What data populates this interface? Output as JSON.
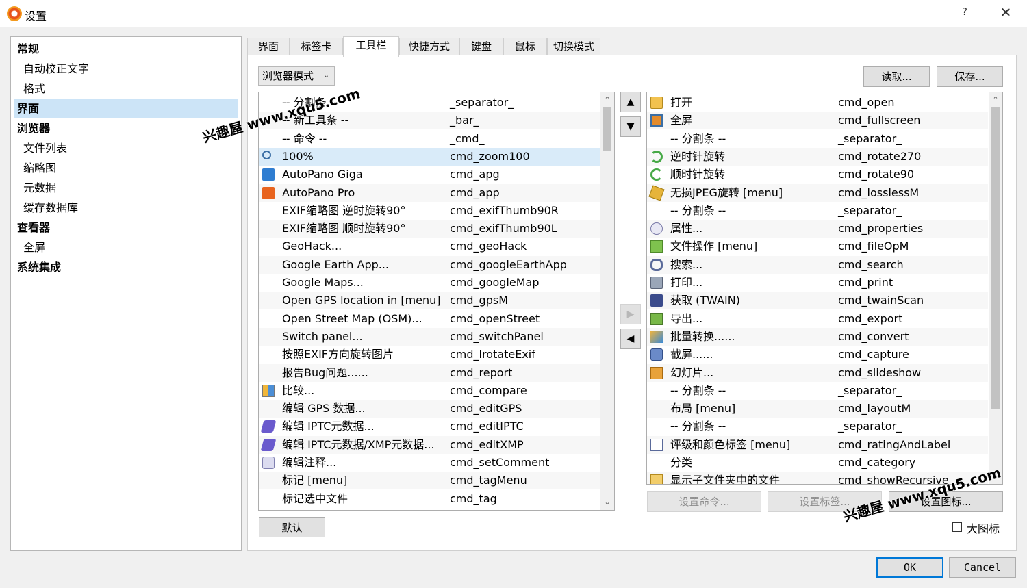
{
  "window": {
    "title": "设置",
    "help": "?",
    "close": "✕"
  },
  "nav": {
    "items": [
      {
        "label": "常规",
        "level": 0
      },
      {
        "label": "自动校正文字",
        "level": 1
      },
      {
        "label": "格式",
        "level": 1
      },
      {
        "label": "界面",
        "level": 0,
        "selected": true
      },
      {
        "label": "浏览器",
        "level": 0
      },
      {
        "label": "文件列表",
        "level": 1
      },
      {
        "label": "缩略图",
        "level": 1
      },
      {
        "label": "元数据",
        "level": 1
      },
      {
        "label": "缓存数据库",
        "level": 1
      },
      {
        "label": "查看器",
        "level": 0
      },
      {
        "label": "全屏",
        "level": 1
      },
      {
        "label": "系统集成",
        "level": 0
      }
    ]
  },
  "tabs": [
    {
      "label": "界面"
    },
    {
      "label": "标签卡"
    },
    {
      "label": "工具栏",
      "active": true
    },
    {
      "label": "快捷方式"
    },
    {
      "label": "键盘"
    },
    {
      "label": "鼠标"
    },
    {
      "label": "切换模式"
    }
  ],
  "toolbar": {
    "mode_value": "浏览器模式",
    "load_label": "读取...",
    "save_label": "保存..."
  },
  "available": [
    {
      "name": "-- 分割条 --",
      "cmd": "_separator_",
      "icon": ""
    },
    {
      "name": "-- 新工具条 --",
      "cmd": "_bar_",
      "icon": ""
    },
    {
      "name": "-- 命令 --",
      "cmd": "_cmd_",
      "icon": ""
    },
    {
      "name": "100%",
      "cmd": "cmd_zoom100",
      "icon": "zoom-icon",
      "selected": true
    },
    {
      "name": "AutoPano Giga",
      "cmd": "cmd_apg",
      "icon": "apg-icon"
    },
    {
      "name": "AutoPano Pro",
      "cmd": "cmd_app",
      "icon": "app-icon"
    },
    {
      "name": "EXIF缩略图 逆时旋转90°",
      "cmd": "cmd_exifThumb90R",
      "icon": ""
    },
    {
      "name": "EXIF缩略图 顺时旋转90°",
      "cmd": "cmd_exifThumb90L",
      "icon": ""
    },
    {
      "name": "GeoHack...",
      "cmd": "cmd_geoHack",
      "icon": ""
    },
    {
      "name": "Google Earth App...",
      "cmd": "cmd_googleEarthApp",
      "icon": ""
    },
    {
      "name": "Google Maps...",
      "cmd": "cmd_googleMap",
      "icon": ""
    },
    {
      "name": "Open GPS location in [menu]",
      "cmd": "cmd_gpsM",
      "icon": ""
    },
    {
      "name": "Open Street Map (OSM)...",
      "cmd": "cmd_openStreet",
      "icon": ""
    },
    {
      "name": "Switch panel...",
      "cmd": "cmd_switchPanel",
      "icon": ""
    },
    {
      "name": "按照EXIF方向旋转图片",
      "cmd": "cmd_lrotateExif",
      "icon": ""
    },
    {
      "name": "报告Bug问题......",
      "cmd": "cmd_report",
      "icon": ""
    },
    {
      "name": "比较...",
      "cmd": "cmd_compare",
      "icon": "compare-icon"
    },
    {
      "name": "编辑 GPS 数据...",
      "cmd": "cmd_editGPS",
      "icon": ""
    },
    {
      "name": "编辑 IPTC元数据...",
      "cmd": "cmd_editIPTC",
      "icon": "edit-meta-icon"
    },
    {
      "name": "编辑 IPTC元数据/XMP元数据...",
      "cmd": "cmd_editXMP",
      "icon": "edit-meta-icon"
    },
    {
      "name": "编辑注释...",
      "cmd": "cmd_setComment",
      "icon": "comment-icon"
    },
    {
      "name": "标记 [menu]",
      "cmd": "cmd_tagMenu",
      "icon": ""
    },
    {
      "name": "标记选中文件",
      "cmd": "cmd_tag",
      "icon": ""
    }
  ],
  "current": [
    {
      "name": "打开",
      "cmd": "cmd_open",
      "icon": "open-icon"
    },
    {
      "name": "全屏",
      "cmd": "cmd_fullscreen",
      "icon": "fullscreen-icon"
    },
    {
      "name": "-- 分割条 --",
      "cmd": "_separator_",
      "icon": ""
    },
    {
      "name": "逆时针旋转",
      "cmd": "cmd_rotate270",
      "icon": "rotate-ccw-icon"
    },
    {
      "name": "顺时针旋转",
      "cmd": "cmd_rotate90",
      "icon": "rotate-cw-icon"
    },
    {
      "name": "无损JPEG旋转 [menu]",
      "cmd": "cmd_losslessM",
      "icon": "lossless-icon"
    },
    {
      "name": "-- 分割条 --",
      "cmd": "_separator_",
      "icon": ""
    },
    {
      "name": "属性...",
      "cmd": "cmd_properties",
      "icon": "properties-icon"
    },
    {
      "name": "文件操作 [menu]",
      "cmd": "cmd_fileOpM",
      "icon": "fileop-icon"
    },
    {
      "name": "搜索...",
      "cmd": "cmd_search",
      "icon": "search-icon"
    },
    {
      "name": "打印...",
      "cmd": "cmd_print",
      "icon": "print-icon"
    },
    {
      "name": "获取 (TWAIN)",
      "cmd": "cmd_twainScan",
      "icon": "scan-icon"
    },
    {
      "name": "导出...",
      "cmd": "cmd_export",
      "icon": "export-icon"
    },
    {
      "name": "批量转换......",
      "cmd": "cmd_convert",
      "icon": "convert-icon"
    },
    {
      "name": "截屏......",
      "cmd": "cmd_capture",
      "icon": "capture-icon"
    },
    {
      "name": "幻灯片...",
      "cmd": "cmd_slideshow",
      "icon": "slideshow-icon"
    },
    {
      "name": "-- 分割条 --",
      "cmd": "_separator_",
      "icon": ""
    },
    {
      "name": "布局 [menu]",
      "cmd": "cmd_layoutM",
      "icon": ""
    },
    {
      "name": "-- 分割条 --",
      "cmd": "_separator_",
      "icon": ""
    },
    {
      "name": "评级和颜色标签 [menu]",
      "cmd": "cmd_ratingAndLabel",
      "icon": "rating-icon"
    },
    {
      "name": "分类",
      "cmd": "cmd_category",
      "icon": ""
    },
    {
      "name": "显示子文件夹中的文件",
      "cmd": "cmd_showRecursive",
      "icon": "subfolder-icon"
    }
  ],
  "move": {
    "up": "▲",
    "down": "▼",
    "add": "▶",
    "remove": "◀"
  },
  "buttons": {
    "default_label": "默认",
    "set_command": "设置命令...",
    "set_label": "设置标签...",
    "set_icon": "设置图标...",
    "large_icons": "大图标",
    "ok": "OK",
    "cancel": "Cancel"
  },
  "watermark": {
    "text": "兴趣屋 www.xqu5.com"
  }
}
